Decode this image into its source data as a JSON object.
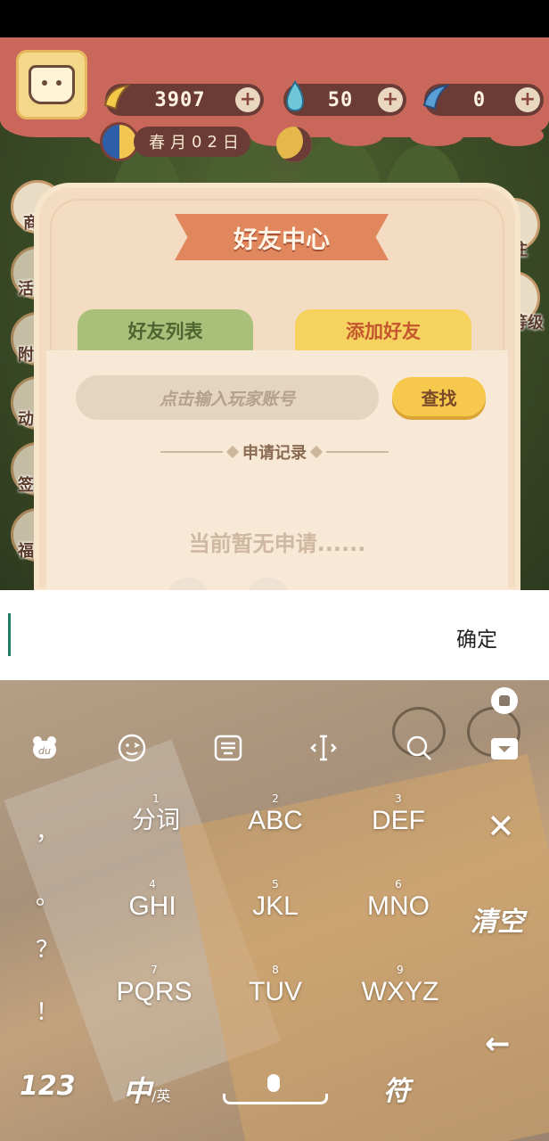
{
  "resources": {
    "bananas": "3907",
    "flames": "50",
    "gems": "0",
    "plus": "+"
  },
  "date": {
    "chars": [
      "春",
      "月",
      "0",
      "2",
      "日"
    ]
  },
  "side_menu": {
    "shop": "商城",
    "map": "前往",
    "level": "等级",
    "left_partial": [
      "活",
      "附",
      "动",
      "签",
      "福"
    ]
  },
  "dialog": {
    "title": "好友中心",
    "tab_list": "好友列表",
    "tab_add": "添加好友",
    "search_placeholder": "点击输入玩家账号",
    "find_button": "查找",
    "section_title": "申请记录",
    "empty_text": "当前暂无申请......"
  },
  "input_bar": {
    "confirm": "确定"
  },
  "keyboard": {
    "toolbar_icons": [
      "du-logo-icon",
      "emoji-icon",
      "keyboard-layout-icon",
      "cursor-icon",
      "search-icon",
      "hide-keyboard-icon"
    ],
    "punctuation": [
      "，",
      "。",
      "？",
      "！"
    ],
    "keys": [
      {
        "num": "1",
        "label": "分词"
      },
      {
        "num": "2",
        "label": "ABC"
      },
      {
        "num": "3",
        "label": "DEF"
      },
      {
        "num": "4",
        "label": "GHI"
      },
      {
        "num": "5",
        "label": "JKL"
      },
      {
        "num": "6",
        "label": "MNO"
      },
      {
        "num": "7",
        "label": "PQRS"
      },
      {
        "num": "8",
        "label": "TUV"
      },
      {
        "num": "9",
        "label": "WXYZ"
      }
    ],
    "delete": "✕",
    "clear": "清空",
    "enter": "←",
    "num_mode": "123",
    "lang_main": "中",
    "lang_sub": "/英",
    "symbols": "符"
  }
}
